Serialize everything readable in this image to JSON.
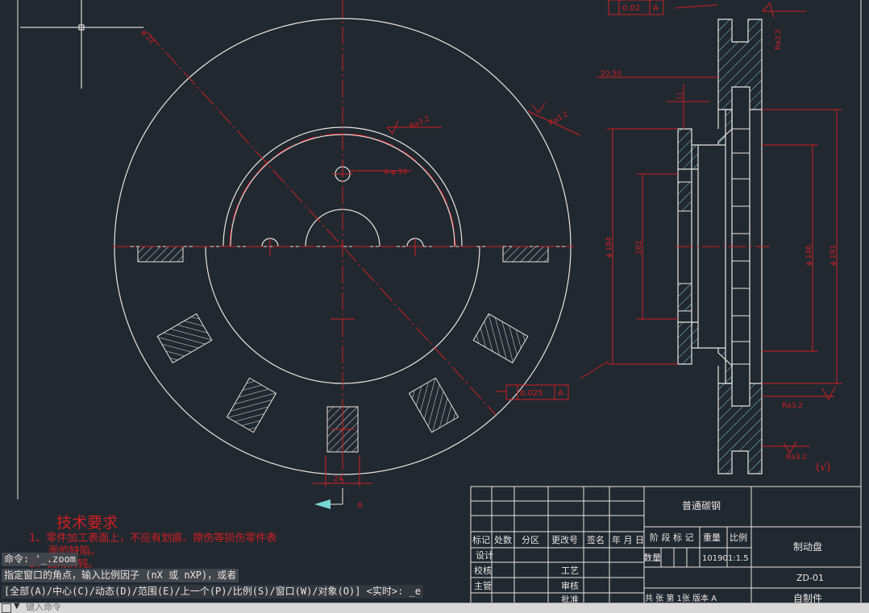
{
  "drawing": {
    "phi_top": "φ 22",
    "ra_left": "Ra3.2",
    "ra_right": "Ra3.2",
    "hole_spec": "4-φ 10",
    "bottom_dim": "24",
    "view_label": "A",
    "tol_runout": "0.025",
    "tol_runout_ref": "A",
    "tol_flat": "0.02",
    "tol_flat_ref": "A",
    "ra_topright": "Ra3.2",
    "dim_2050": "20.50",
    "dim_small": "11",
    "dim_phi_a": "φ 184",
    "dim_phi_b": "182",
    "dim_phi_c": "φ 146",
    "dim_phi_d": "φ 191",
    "ra_r1": "Ra3.2",
    "ra_r2": "Ra3.2",
    "check_mark": "(√)",
    "tech_title": "技术要求",
    "tech_line1": "1、零件加工表面上，不应有划痕、擦伤等损伤零件表",
    "tech_line2": "面的缺陷。",
    "tech_line3": "2、锐角倒钝。"
  },
  "title_block": {
    "h_mark": "标记",
    "h_count": "处数",
    "h_zone": "分区",
    "h_docno": "更改号",
    "h_sign": "签名",
    "h_date": "年 月 日",
    "r_design": "设计",
    "r_check": "校核",
    "r_chief": "主管",
    "r_process": "工艺",
    "r_review": "审核",
    "r_approve": "批准",
    "material": "普通碳钢",
    "stage_mark": "阶 段 标 记",
    "weight_label": "重量",
    "scale_label": "比例",
    "qty_label": "数量",
    "weight_val": "10190",
    "scale_val": "1:1.5",
    "part_name": "制动盘",
    "drawing_no": "ZD-01",
    "sheet_info": "共  张   第 1张  版本 A",
    "part_type": "自制件"
  },
  "command": {
    "prev1": "命令: '_.zoom",
    "prev2": "指定窗口的角点，输入比例因子 (nX 或 nXP)，或者",
    "options": "[全部(A)/中心(C)/动态(D)/范围(E)/上一个(P)/比例(S)/窗口(W)/对象(O)] <实时>: _e",
    "placeholder": "键入命令"
  },
  "colors": {
    "background": "#212830",
    "geometry": "#e6e6e6",
    "centerline": "#cf1f1f",
    "hatch": "#7ad6d6"
  }
}
